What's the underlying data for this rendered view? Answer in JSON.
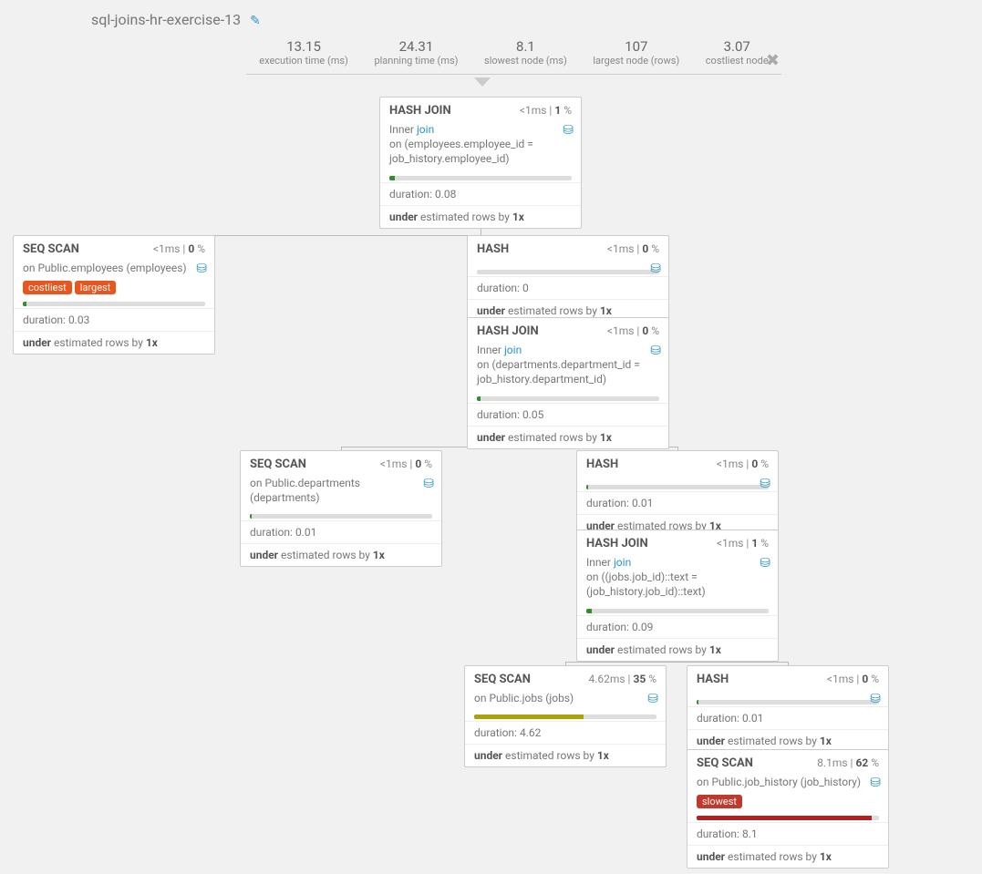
{
  "title": "sql-joins-hr-exercise-13",
  "metrics": {
    "exec_val": "13.15",
    "exec_lab": "execution time (ms)",
    "plan_val": "24.31",
    "plan_lab": "planning time (ms)",
    "slow_val": "8.1",
    "slow_lab": "slowest node (ms)",
    "large_val": "107",
    "large_lab": "largest node (rows)",
    "cost_val": "3.07",
    "cost_lab": "costliest node"
  },
  "labels": {
    "inner": "Inner",
    "join": "join",
    "on": "on",
    "duration": "duration:",
    "under": "under",
    "est_tail": "estimated rows by",
    "db_glyph": "⛁"
  },
  "badges": {
    "costliest": "costliest",
    "largest": "largest",
    "slowest": "slowest"
  },
  "nodes": {
    "n1": {
      "title": "HASH JOIN",
      "time": "<1ms",
      "pct": "1",
      "cond": "(employees.employee_id = job_history.employee_id)",
      "dur": "0.08",
      "est": "1x",
      "fill": 3,
      "color": "green"
    },
    "n2": {
      "title": "SEQ SCAN",
      "time": "<1ms",
      "pct": "0",
      "on_text": "Public.employees (employees)",
      "dur": "0.03",
      "est": "1x",
      "fill": 2,
      "color": "green",
      "badges": [
        "costliest",
        "largest"
      ]
    },
    "n3": {
      "title": "HASH",
      "time": "<1ms",
      "pct": "0",
      "dur": "0",
      "est": "1x",
      "fill": 0,
      "color": "green"
    },
    "n4": {
      "title": "HASH JOIN",
      "time": "<1ms",
      "pct": "0",
      "cond": "(departments.department_id = job_history.department_id)",
      "dur": "0.05",
      "est": "1x",
      "fill": 2,
      "color": "green"
    },
    "n5": {
      "title": "SEQ SCAN",
      "time": "<1ms",
      "pct": "0",
      "on_text": "Public.departments (departments)",
      "dur": "0.01",
      "est": "1x",
      "fill": 1,
      "color": "green"
    },
    "n6": {
      "title": "HASH",
      "time": "<1ms",
      "pct": "0",
      "dur": "0.01",
      "est": "1x",
      "fill": 1,
      "color": "green"
    },
    "n7": {
      "title": "HASH JOIN",
      "time": "<1ms",
      "pct": "1",
      "cond": "((jobs.job_id)::text = (job_history.job_id)::text)",
      "dur": "0.09",
      "est": "1x",
      "fill": 3,
      "color": "green"
    },
    "n8": {
      "title": "SEQ SCAN",
      "time": "4.62ms",
      "pct": "35",
      "on_text": "Public.jobs (jobs)",
      "dur": "4.62",
      "est": "1x",
      "fill": 60,
      "color": "olive"
    },
    "n9": {
      "title": "HASH",
      "time": "<1ms",
      "pct": "0",
      "dur": "0.01",
      "est": "1x",
      "fill": 1,
      "color": "green"
    },
    "n10": {
      "title": "SEQ SCAN",
      "time": "8.1ms",
      "pct": "62",
      "on_text": "Public.job_history (job_history)",
      "dur": "8.1",
      "est": "1x",
      "fill": 96,
      "color": "redf",
      "badges": [
        "slowest"
      ]
    }
  }
}
